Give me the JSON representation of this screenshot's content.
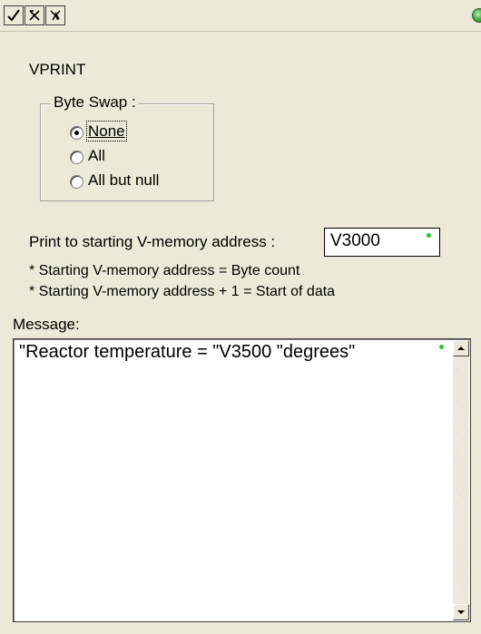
{
  "toolbar": {
    "buttons": [
      {
        "icon": "check-icon"
      },
      {
        "icon": "cancel-x-icon"
      },
      {
        "icon": "help-icon"
      }
    ],
    "status_color": "#3aa43a"
  },
  "title": "VPRINT",
  "byte_swap": {
    "legend": "Byte Swap :",
    "options": [
      {
        "label": "None",
        "checked": true
      },
      {
        "label": "All",
        "checked": false
      },
      {
        "label": "All but null",
        "checked": false
      }
    ]
  },
  "address": {
    "label": "Print to starting V-memory address :",
    "value": "V3000"
  },
  "notes": [
    "* Starting V-memory address = Byte count",
    "* Starting V-memory address + 1 = Start of data"
  ],
  "message": {
    "label": "Message:",
    "text": "\"Reactor temperature = \"V3500 \"degrees\""
  }
}
